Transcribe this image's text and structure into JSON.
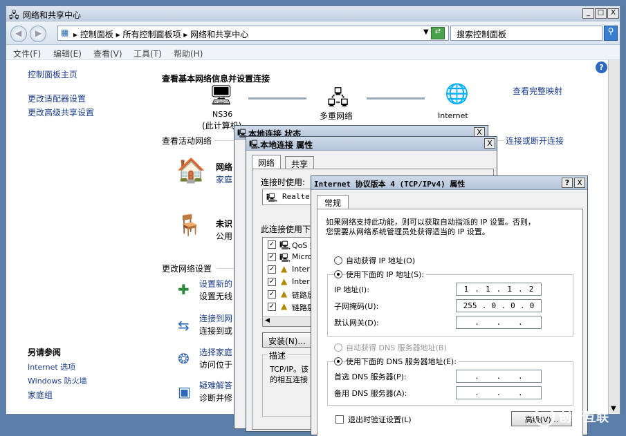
{
  "window": {
    "title": "网络和共享中心",
    "minimize": "_",
    "maximize": "□",
    "close": "X"
  },
  "addressbar": {
    "crumb": "▸ 控制面板 ▸ 所有控制面板项 ▸ 网络和共享中心",
    "search_placeholder": "搜索控制面板"
  },
  "menu": [
    "文件(F)",
    "编辑(E)",
    "查看(V)",
    "工具(T)",
    "帮助(H)"
  ],
  "sidebar": {
    "home": "控制面板主页",
    "links": [
      "更改适配器设置",
      "更改高级共享设置"
    ],
    "see_also_title": "另请参阅",
    "see_also": [
      "Internet 选项",
      "Windows 防火墙",
      "家庭组"
    ]
  },
  "main": {
    "heading": "查看基本网络信息并设置连接",
    "view_full_map": "查看完整映射",
    "map": {
      "node1_line1": "NS36",
      "node1_line2": "(此计算机)",
      "node2": "多重网络",
      "node3": "Internet"
    },
    "active_networks_label": "查看活动网络",
    "connect_disconnect": "连接或断开连接",
    "network1_name": "网络",
    "network1_type": "家庭",
    "network2_name": "未识",
    "network2_type": "公用",
    "change_settings_label": "更改网络设置",
    "tasks": [
      {
        "l1": "设置新的",
        "l2": "设置无线"
      },
      {
        "l1": "连接到网",
        "l2": "连接到或"
      },
      {
        "l1": "选择家庭",
        "l2": "访问位于"
      },
      {
        "l1": "疑难解答",
        "l2": "诊断并修"
      }
    ]
  },
  "status_dialog": {
    "title": "本地连接 状态",
    "close": "X"
  },
  "props_dialog": {
    "title": "本地连接 属性",
    "close": "X",
    "tabs": [
      "网络",
      "共享"
    ],
    "connect_using": "连接时使用:",
    "adapter": "Realte",
    "items_label": "此连接使用下",
    "items": [
      "QoS 数",
      "Micro",
      "Inter",
      "Inter",
      "链路层",
      "链路层"
    ],
    "install_btn": "安装(N)...",
    "desc_label": "描述",
    "desc_l1": "TCP/IP。该",
    "desc_l2": "的相互连接"
  },
  "tcpip_dialog": {
    "title": "Internet 协议版本 4 (TCP/IPv4) 属性",
    "help": "?",
    "close": "X",
    "tab": "常规",
    "intro_l1": "如果网络支持此功能，则可以获取自动指派的 IP 设置。否则，",
    "intro_l2": "您需要从网络系统管理员处获得适当的 IP 设置。",
    "auto_ip": "自动获得 IP 地址(O)",
    "manual_ip": "使用下面的 IP 地址(S):",
    "ip_label": "IP 地址(I):",
    "ip_value": [
      "1",
      "1",
      "1",
      "2"
    ],
    "mask_label": "子网掩码(U):",
    "mask_value": [
      "255",
      "0",
      "0",
      "0"
    ],
    "gw_label": "默认网关(D):",
    "auto_dns": "自动获得 DNS 服务器地址(B)",
    "manual_dns": "使用下面的 DNS 服务器地址(E):",
    "dns1_label": "首选 DNS 服务器(P):",
    "dns2_label": "备用 DNS 服务器(A):",
    "validate": "退出时验证设置(L)",
    "advanced_btn": "高级(V)..."
  },
  "watermark": "创新互联"
}
